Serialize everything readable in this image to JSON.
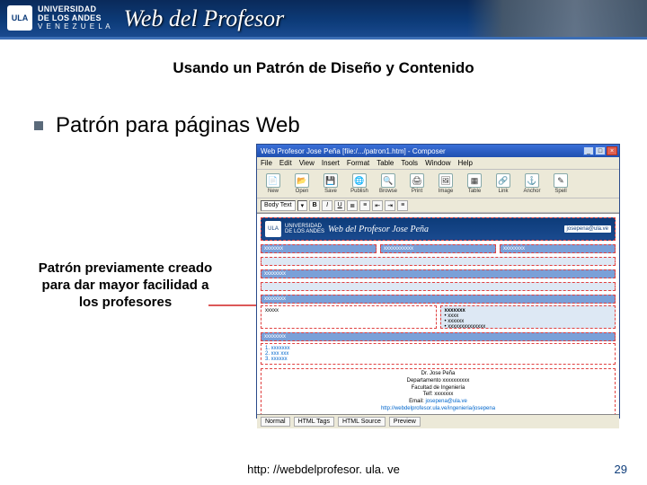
{
  "banner": {
    "university_line1": "UNIVERSIDAD",
    "university_line2": "DE LOS ANDES",
    "university_sub": "V E N E Z U E L A",
    "title": "Web del Profesor",
    "crest_abbrev": "ULA"
  },
  "slide": {
    "title": "Usando un Patrón de Diseño y Contenido",
    "bullet": "Patrón para páginas Web",
    "caption": "Patrón previamente creado para dar mayor facilidad a los profesores"
  },
  "composer": {
    "window_title": "Web Profesor Jose Peña [file:/.../patron1.htm] - Composer",
    "menu": [
      "File",
      "Edit",
      "View",
      "Insert",
      "Format",
      "Table",
      "Tools",
      "Window",
      "Help"
    ],
    "toolbar": [
      {
        "icon": "📄",
        "label": "New"
      },
      {
        "icon": "📂",
        "label": "Open"
      },
      {
        "icon": "💾",
        "label": "Save"
      },
      {
        "icon": "🌐",
        "label": "Publish"
      },
      {
        "icon": "🔍",
        "label": "Browse"
      },
      {
        "icon": "🖨",
        "label": "Print"
      },
      {
        "icon": "🖼",
        "label": "Image"
      },
      {
        "icon": "▦",
        "label": "Table"
      },
      {
        "icon": "🔗",
        "label": "Link"
      },
      {
        "icon": "⚓",
        "label": "Anchor"
      },
      {
        "icon": "✎",
        "label": "Spell"
      }
    ],
    "format_dropdown": "Body Text",
    "inner_page": {
      "uni1": "UNIVERSIDAD",
      "uni2": "DE LOS ANDES",
      "prof_title": "Web del Profesor Jose Peña",
      "email_badge": "josepena@ula.ve",
      "nav": [
        "xxxxxxx",
        "xxxxxxxxxxx",
        "xxxxxxxx"
      ],
      "section1": "xxxxxxxx",
      "section2": "xxxxxxxx",
      "col_left": "xxxxx",
      "col_right": {
        "h": "xxxxxxx",
        "items": [
          "xxxx",
          "xxxxxx",
          "xxxxxxxxxxxxxx"
        ]
      },
      "section3": "xxxxxxxx",
      "numbered": [
        "xxxxxxx",
        "xxx xxx",
        "xxxxxx"
      ],
      "signature": {
        "name": "Dr. Jose Peña",
        "dept": "Departamento xxxxxxxxxx",
        "fac": "Facultad de Ingeniería",
        "tel": "Telf: xxxxxxx",
        "email_label": "Email:",
        "email": "josepena@ula.ve",
        "url": "http://webdelprofesor.ula.ve/ingenieria/josepena"
      }
    },
    "status_tabs": [
      "Normal",
      "HTML Tags",
      "HTML Source",
      "Preview"
    ]
  },
  "footer": {
    "url": "http: //webdelprofesor. ula. ve",
    "page": "29"
  }
}
